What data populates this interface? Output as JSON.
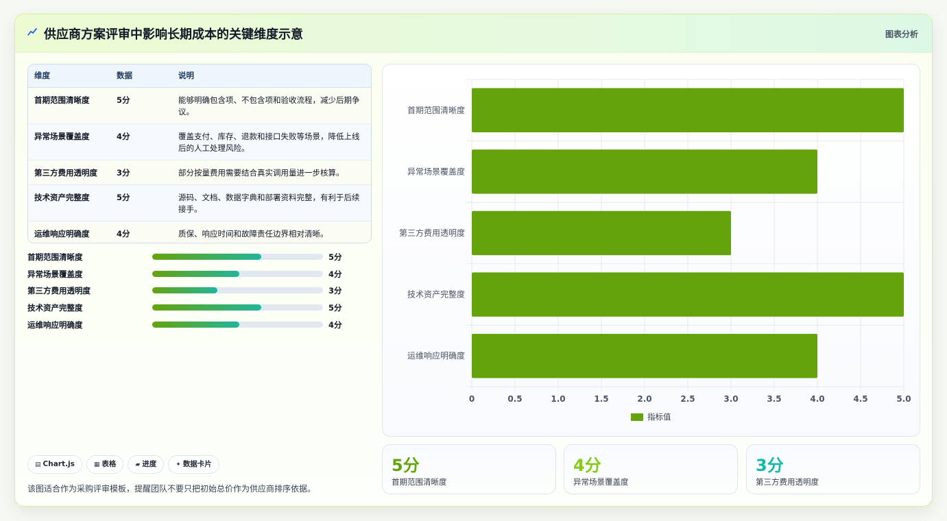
{
  "header": {
    "title": "供应商方案评审中影响长期成本的关键维度示意",
    "tag": "图表分析"
  },
  "table": {
    "columns": [
      "维度",
      "数据",
      "说明"
    ],
    "rows": [
      {
        "dim": "首期范围清晰度",
        "score": "5分",
        "desc": "能够明确包含项、不包含项和验收流程，减少后期争议。"
      },
      {
        "dim": "异常场景覆盖度",
        "score": "4分",
        "desc": "覆盖支付、库存、退款和接口失败等场景，降低上线后的人工处理风险。"
      },
      {
        "dim": "第三方费用透明度",
        "score": "3分",
        "desc": "部分按量费用需要结合真实调用量进一步核算。"
      },
      {
        "dim": "技术资产完整度",
        "score": "5分",
        "desc": "源码、文档、数据字典和部署资料完整，有利于后续接手。"
      },
      {
        "dim": "运维响应明确度",
        "score": "4分",
        "desc": "质保、响应时间和故障责任边界相对清晰。"
      }
    ]
  },
  "progress": [
    {
      "label": "首期范围清晰度",
      "value": "5分",
      "fraction": 0.64
    },
    {
      "label": "异常场景覆盖度",
      "value": "4分",
      "fraction": 0.51
    },
    {
      "label": "第三方费用透明度",
      "value": "3分",
      "fraction": 0.38
    },
    {
      "label": "技术资产完整度",
      "value": "5分",
      "fraction": 0.64
    },
    {
      "label": "运维响应明确度",
      "value": "4分",
      "fraction": 0.51
    }
  ],
  "chips": [
    {
      "icon": "▤",
      "label": "Chart.js"
    },
    {
      "icon": "▦",
      "label": "表格"
    },
    {
      "icon": "▰",
      "label": "进度"
    },
    {
      "icon": "✦",
      "label": "数据卡片"
    }
  ],
  "note": "该图适合作为采购评审模板，提醒团队不要只把初始总价作为供应商排序依据。",
  "kpis": [
    {
      "value": "5分",
      "caption": "首期范围清晰度",
      "color": "#65a30d"
    },
    {
      "value": "4分",
      "caption": "异常场景覆盖度",
      "color": "#84cc16"
    },
    {
      "value": "3分",
      "caption": "第三方费用透明度",
      "color": "#14b8a6"
    }
  ],
  "colors": {
    "bar": "#65a30d",
    "accent": "#65a30d"
  },
  "chart_data": {
    "type": "bar",
    "orientation": "horizontal",
    "categories": [
      "首期范围清晰度",
      "异常场景覆盖度",
      "第三方费用透明度",
      "技术资产完整度",
      "运维响应明确度"
    ],
    "series": [
      {
        "name": "指标值",
        "values": [
          5,
          4,
          3,
          5,
          4
        ]
      }
    ],
    "xlim": [
      0,
      5
    ],
    "xticks": [
      "0",
      "0.5",
      "1.0",
      "1.5",
      "2.0",
      "2.5",
      "3.0",
      "3.5",
      "4.0",
      "4.5",
      "5.0"
    ],
    "grid": true,
    "legend": "bottom"
  }
}
